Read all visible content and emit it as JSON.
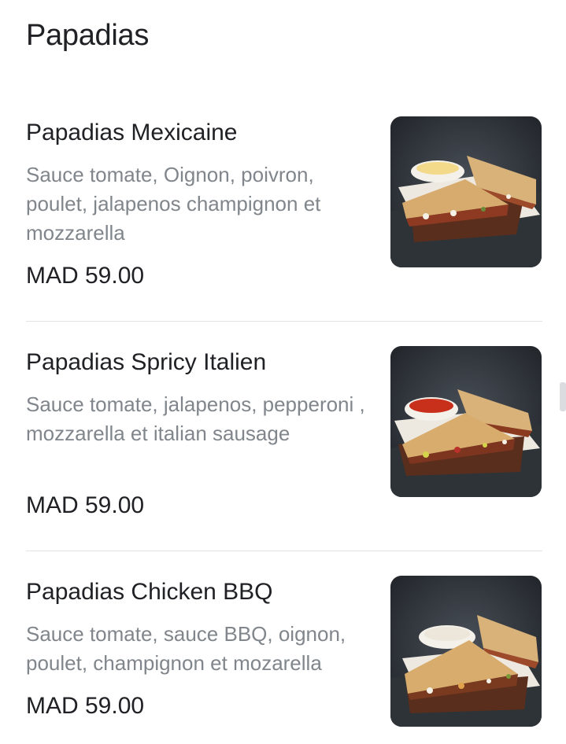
{
  "section": {
    "title": "Papadias"
  },
  "items": [
    {
      "name": "Papadias Mexicaine",
      "description": "Sauce tomate, Oignon, poivron, poulet, jalapenos champignon et mozzarella",
      "price": "MAD 59.00",
      "image_icon": "papadia-photo-icon"
    },
    {
      "name": "Papadias Spricy Italien",
      "description": "Sauce tomate, jalapenos, pepperoni , mozzarella et italian sausage",
      "price": "MAD 59.00",
      "image_icon": "papadia-photo-icon"
    },
    {
      "name": "Papadias Chicken BBQ",
      "description": "Sauce tomate, sauce BBQ, oignon, poulet, champignon et mozarella",
      "price": "MAD 59.00",
      "image_icon": "papadia-photo-icon"
    }
  ],
  "colors": {
    "text_primary": "#202124",
    "text_secondary": "#80868b",
    "divider": "#e3e3e3",
    "photo_background": "#2b3036"
  }
}
